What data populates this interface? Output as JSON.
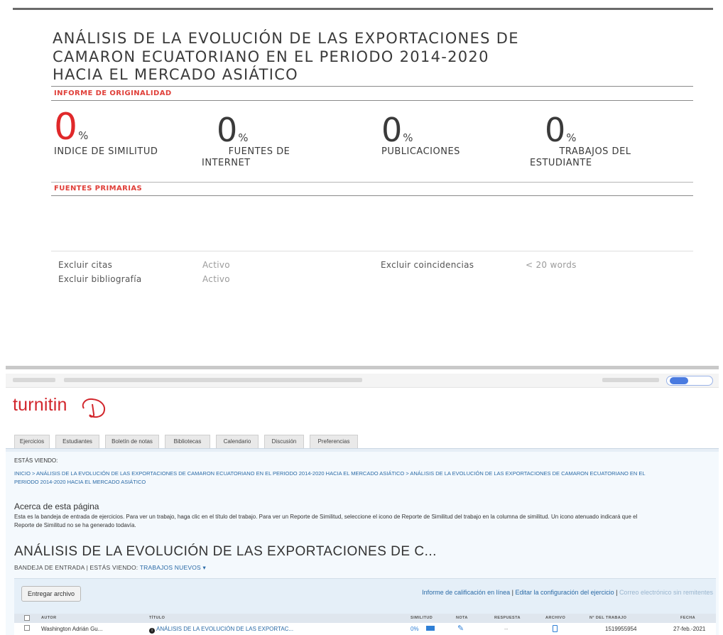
{
  "report": {
    "title_lines": [
      "ANÁLISIS DE LA EVOLUCIÓN DE LAS EXPORTACIONES DE",
      "CAMARON ECUATORIANO EN EL PERIODO 2014-2020",
      "HACIA EL MERCADO ASIÁTICO"
    ],
    "originality_label": "INFORME DE ORIGINALIDAD",
    "stats": [
      {
        "value": "0",
        "unit": "%",
        "label": "INDICE DE SIMILITUD",
        "color": "#e0282a"
      },
      {
        "value": "0",
        "unit": "%",
        "label": "FUENTES DE INTERNET",
        "color": "#3a3a3a"
      },
      {
        "value": "0",
        "unit": "%",
        "label": "PUBLICACIONES",
        "color": "#3a3a3a"
      },
      {
        "value": "0",
        "unit": "%",
        "label": "TRABAJOS DEL ESTUDIANTE",
        "color": "#3a3a3a"
      }
    ],
    "stat_label_lines": {
      "internet_1": "FUENTES DE",
      "internet_2": "INTERNET",
      "student_1": "TRABAJOS DEL",
      "student_2": "ESTUDIANTE"
    },
    "primary_sources_label": "FUENTES PRIMARIAS",
    "exclusions": {
      "citas_label": "Excluir citas",
      "citas_value": "Activo",
      "biblio_label": "Excluir bibliografía",
      "biblio_value": "Activo",
      "coinc_label": "Excluir coincidencias",
      "coinc_value": "< 20 words"
    }
  },
  "turnitin": {
    "logo_text": "turnitin",
    "brand_color": "#d2262c",
    "tabs": [
      "Ejercicios",
      "Estudiantes",
      "Boletín de notas",
      "Bibliotecas",
      "Calendario",
      "Discusión",
      "Preferencias"
    ],
    "viewing_label": "ESTÁS VIENDO:",
    "breadcrumb_line1": "INICIO > ANÁLISIS DE LA EVOLUCIÓN DE LAS EXPORTACIONES DE CAMARON ECUATORIANO EN EL PERIODO 2014-2020 HACIA EL MERCADO ASIÁTICO > ANÁLISIS DE LA EVOLUCIÓN DE LAS EXPORTACIONES DE CAMARON ECUATORIANO EN EL",
    "breadcrumb_line2": "PERIODO 2014-2020 HACIA EL MERCADO ASIÁTICO",
    "about_heading": "Acerca de esta página",
    "about_line1": "Esta es la bandeja de entrada de ejercicios. Para ver un trabajo, haga clic en el título del trabajo. Para ver un Reporte de Similitud, seleccione el icono de Reporte de Similitud del trabajo en la columna de similitud. Un icono atenuado indicará que el",
    "about_line2": "Reporte de Similitud no se ha generado todavía.",
    "assignment_title": "ANÁLISIS DE LA EVOLUCIÓN DE LAS EXPORTACIONES DE C...",
    "inbox_prefix": "BANDEJA DE ENTRADA | ESTÁS VIENDO:",
    "inbox_filter": "TRABAJOS NUEVOS ▾",
    "submit_button": "Entregar archivo",
    "toolbar_link1": "Informe de calificación en línea",
    "toolbar_sep": " | ",
    "toolbar_link2": "Editar la configuración del ejercicio",
    "toolbar_link3": "Correo electrónico sin remitentes",
    "columns": [
      "AUTOR",
      "TÍTULO",
      "SIMILITUD",
      "NOTA",
      "RESPUESTA",
      "ARCHIVO",
      "N° DEL TRABAJO",
      "FECHA"
    ],
    "row": {
      "author": "Washington Adrián Gu...",
      "title": "ANÁLISIS DE LA EVOLUCIÓN DE LAS EXPORTAC...",
      "similarity": "0%",
      "response": "--",
      "paper_id": "1519955954",
      "date": "27-feb.-2021"
    }
  }
}
